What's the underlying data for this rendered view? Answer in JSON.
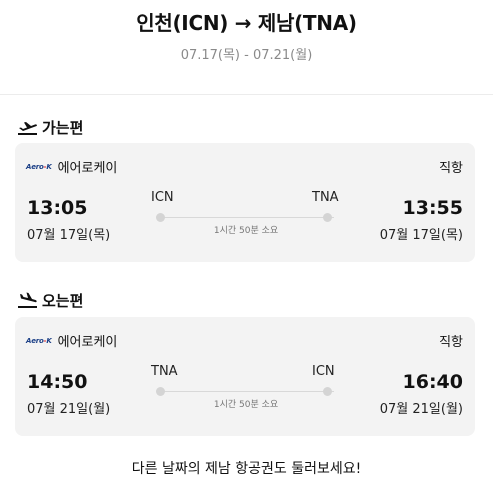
{
  "header": {
    "route_title": "인천(ICN) → 제남(TNA)",
    "dates": "07.17(목) - 07.21(월)"
  },
  "outbound": {
    "section_label": "가는편",
    "icon": "plane-takeoff-icon",
    "airline_logo_text": "Aero K",
    "airline_name": "에어로케이",
    "flight_type": "직항",
    "departure_time": "13:05",
    "departure_date": "07월 17일(목)",
    "departure_code": "ICN",
    "arrival_code": "TNA",
    "duration": "1시간 50분 소요",
    "arrival_time": "13:55",
    "arrival_date": "07월 17일(목)"
  },
  "inbound": {
    "section_label": "오는편",
    "icon": "plane-landing-icon",
    "airline_logo_text": "Aero K",
    "airline_name": "에어로케이",
    "flight_type": "직항",
    "departure_time": "14:50",
    "departure_date": "07월 21일(월)",
    "departure_code": "TNA",
    "arrival_code": "ICN",
    "duration": "1시간 50분 소요",
    "arrival_time": "16:40",
    "arrival_date": "07월 21일(월)"
  },
  "footer": {
    "message": "다른 날짜의 제남 항공권도 둘러보세요!"
  }
}
